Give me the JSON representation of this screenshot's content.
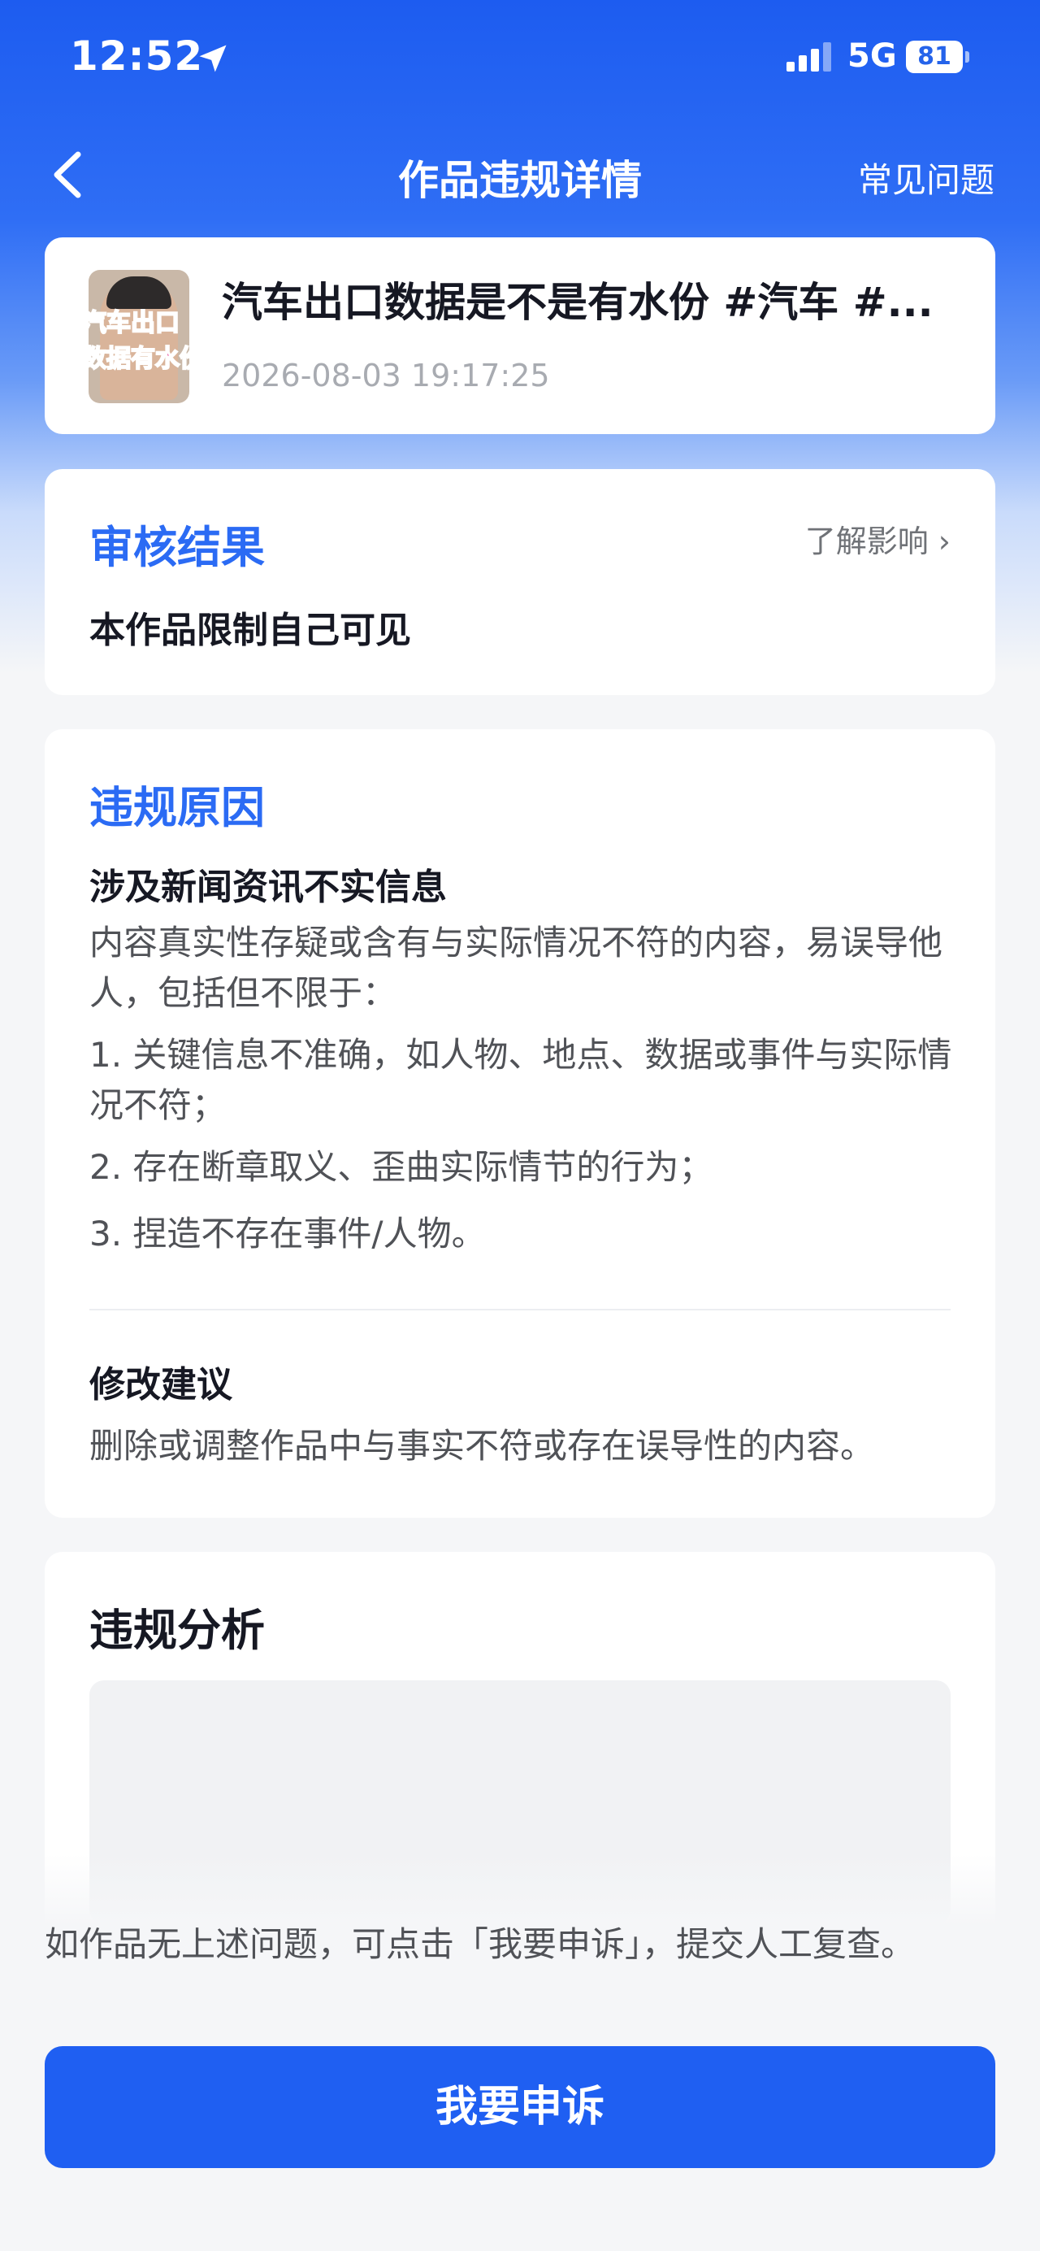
{
  "status_bar": {
    "time": "12:52",
    "network": "5G",
    "battery": "81",
    "icons": [
      "location-arrow-icon",
      "signal-bars-icon",
      "battery-icon"
    ]
  },
  "nav": {
    "back_icon": "chevron-left-icon",
    "title": "作品违规详情",
    "faq": "常见问题"
  },
  "work": {
    "thumbnail_text_line1": "汽车出口",
    "thumbnail_text_line2": "数据有水份",
    "title": "汽车出口数据是不是有水份 #汽车 #...",
    "time": "2026-08-03 19:17:25"
  },
  "review": {
    "title": "审核结果",
    "learn_more": "了解影响 ›",
    "result": "本作品限制自己可见"
  },
  "reason": {
    "title": "违规原因",
    "name": "涉及新闻资讯不实信息",
    "description": "内容真实性存疑或含有与实际情况不符的内容，易误导他人，包括但不限于：",
    "items": [
      "1. 关键信息不准确，如人物、地点、数据或事件与实际情况不符；",
      "2. 存在断章取义、歪曲实际情节的行为；",
      "3. 捏造不存在事件/人物。"
    ],
    "suggestion_title": "修改建议",
    "suggestion": "删除或调整作品中与事实不符或存在误导性的内容。"
  },
  "analysis": {
    "title": "违规分析"
  },
  "bottom": {
    "note": "如作品无上述问题，可点击「我要申诉」，提交人工复查。",
    "appeal_button": "我要申诉"
  },
  "colors": {
    "accent_blue": "#2b6bf4",
    "button_blue": "#1f5ff2",
    "header_blue": "#1d5cf0",
    "thumbnail_text": "#e2187d"
  }
}
